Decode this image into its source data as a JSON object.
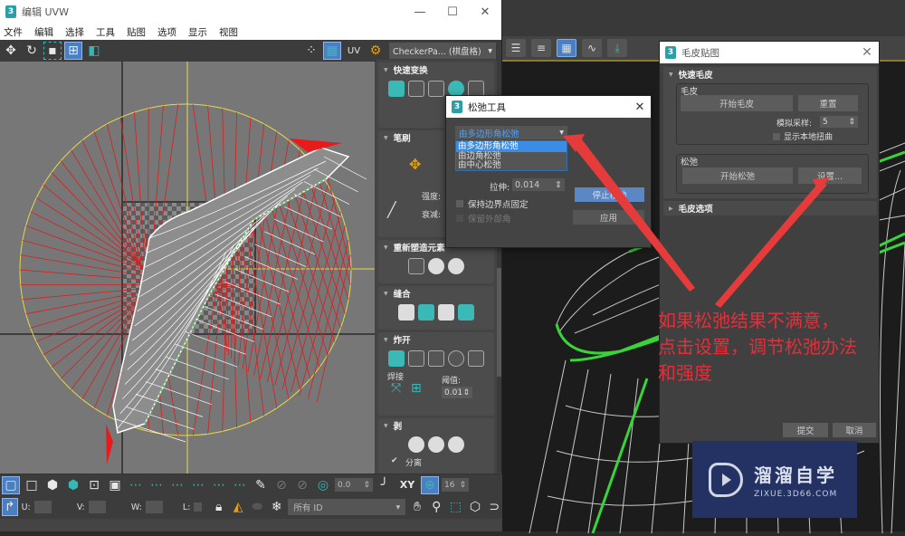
{
  "uvw_editor": {
    "title": "编辑 UVW",
    "app_icon": "3",
    "window_controls": {
      "minimize": "—",
      "maximize": "☐",
      "close": "✕"
    },
    "menu": [
      "文件",
      "编辑",
      "选择",
      "工具",
      "贴图",
      "选项",
      "显示",
      "视图"
    ],
    "toolbar": {
      "icons": [
        "move-icon",
        "rotate-icon",
        "scale-icon",
        "freeform-icon",
        "mirror-icon"
      ],
      "right_icons": [
        "show-map-icon",
        "checker-map-icon",
        "uv-icon",
        "texture-settings-icon"
      ],
      "uv_label": "UV",
      "checker_select": "CheckerPa... (棋盘格)"
    },
    "rollouts": {
      "quick_transform": {
        "title": "快速变换"
      },
      "brush": {
        "title": "笔刷",
        "strength_label": "强度:",
        "falloff_label": "衰减:"
      },
      "rearrange": {
        "title": "重新塑造元素"
      },
      "stitch": {
        "title": "缝合"
      },
      "explode": {
        "title": "炸开",
        "weld_label": "焊接",
        "threshold_label": "阈值:",
        "threshold_value": "0.01"
      },
      "peel": {
        "title": "剥",
        "detach_label": "分离",
        "detach_checked": true
      }
    },
    "bottom_toolbar": {
      "angle_value": "0.0",
      "xy_label": "XY",
      "grid_value": "16",
      "u_label": "U:",
      "v_label": "V:",
      "w_label": "W:",
      "l_label": "L:",
      "id_select": "所有 ID"
    }
  },
  "viewport_toolbar": {
    "icons": [
      "scene-explorer-icon",
      "layer-explorer-icon",
      "schematic-view-icon",
      "curve-editor-icon",
      "render-setup-icon"
    ]
  },
  "relax_tool": {
    "title": "松弛工具",
    "method_selected": "由多边形角松弛",
    "method_options": [
      "由多边形角松弛",
      "由边角松弛",
      "由中心松弛"
    ],
    "stretch_label": "拉伸:",
    "stretch_value": "0.014",
    "keep_boundary_label": "保持边界点固定",
    "keep_boundary_checked": false,
    "save_outer_label": "保留外部角",
    "save_outer_checked": false,
    "stop_relax_label": "停止松弛",
    "apply_label": "应用",
    "close": "✕"
  },
  "skin_map": {
    "title": "毛皮贴图",
    "close": "✕",
    "quick_pelt": {
      "title": "快速毛皮",
      "pelt_group": "毛皮",
      "start_pelt": "开始毛皮",
      "reset": "重置",
      "sim_samples_label": "模拟采样:",
      "sim_samples_value": "5",
      "show_local_distortion": "显示本地扭曲",
      "show_local_distortion_checked": false,
      "relax_group": "松弛",
      "start_relax": "开始松弛",
      "settings": "设置..."
    },
    "pelt_options": {
      "title": "毛皮选项"
    },
    "commit": "提交",
    "cancel": "取消"
  },
  "annotation": {
    "lines": [
      "如果松弛结果不满意，",
      "点击设置，调节松弛办法",
      "和强度"
    ],
    "color": "#e0303a"
  },
  "watermark": {
    "name": "溜溜自学",
    "url": "ZIXUE.3D66.COM"
  }
}
